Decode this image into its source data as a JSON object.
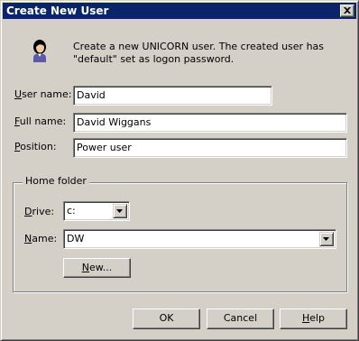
{
  "window": {
    "title": "Create New User",
    "close_icon": "close-x-icon"
  },
  "info": {
    "icon": "user-icon",
    "text": "Create a new UNICORN user. The created user has\n\"default\" set as logon password."
  },
  "form": {
    "user_name": {
      "label_mnemonic": "U",
      "label_rest": "ser name:",
      "value": "David"
    },
    "full_name": {
      "label_mnemonic": "F",
      "label_rest": "ull name:",
      "value": "David Wiggans"
    },
    "position": {
      "label_mnemonic": "P",
      "label_rest": "osition:",
      "value": "Power user"
    }
  },
  "home_folder": {
    "legend": "Home folder",
    "drive": {
      "label_mnemonic": "D",
      "label_rest": "rive:",
      "value": "c:"
    },
    "name": {
      "label_mnemonic": "N",
      "label_rest": "ame:",
      "value": "DW"
    },
    "new_button": {
      "label_mnemonic": "N",
      "label_rest": "ew..."
    }
  },
  "buttons": {
    "ok": "OK",
    "cancel": "Cancel",
    "help_mnemonic": "H",
    "help_rest": "elp"
  },
  "colors": {
    "titlebar": "#0a246a",
    "face": "#d4d0c8"
  }
}
